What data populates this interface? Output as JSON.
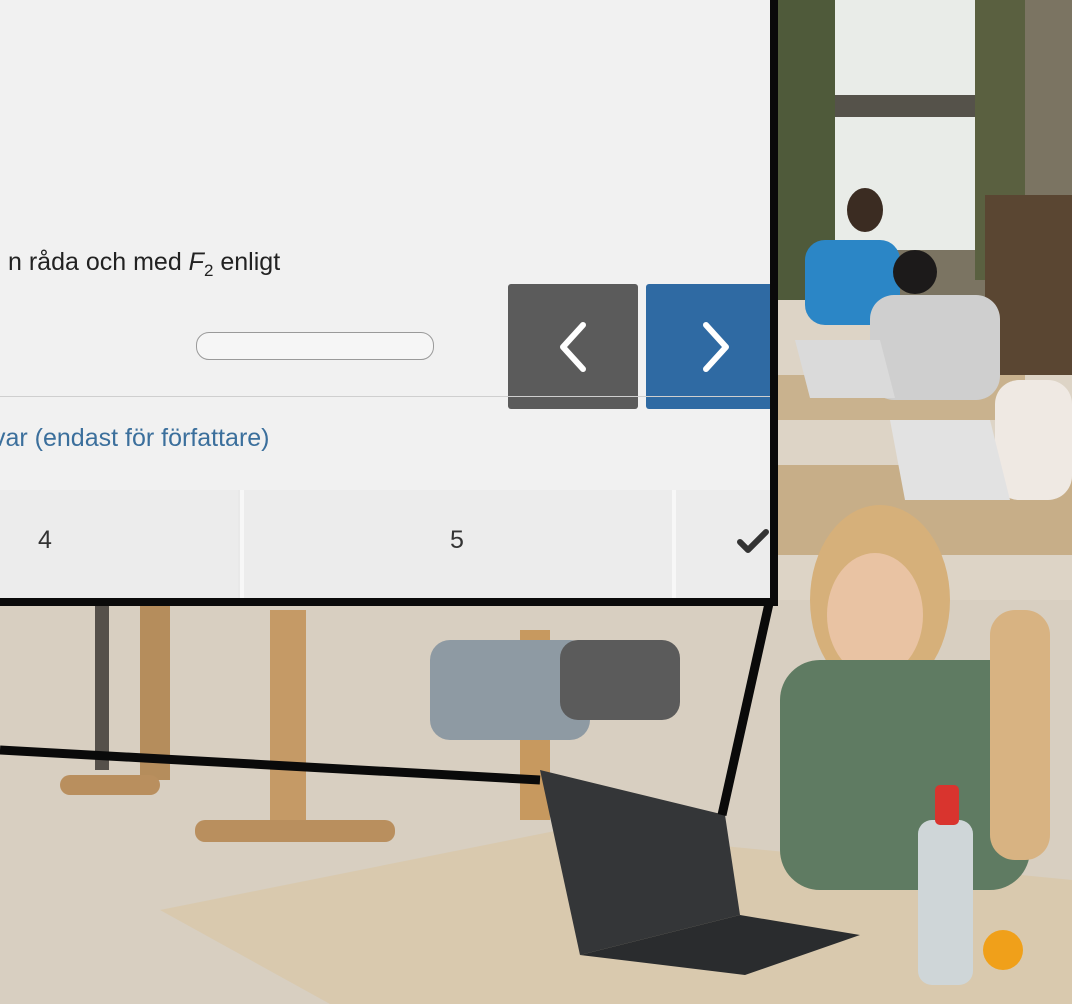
{
  "question": {
    "text_start": "n råda och med ",
    "math_var": "F",
    "math_sub": "2",
    "text_end": " enligt"
  },
  "answer_input": {
    "value": ""
  },
  "author_link": {
    "label": "var (endast för författare)"
  },
  "navigation": {
    "prev_icon": "chevron-left-icon",
    "next_icon": "chevron-right-icon"
  },
  "options": [
    {
      "label": "4"
    },
    {
      "label": "5"
    }
  ],
  "options_status_icon": "checkmark-icon",
  "colors": {
    "prev_button": "#5b5b5b",
    "next_button": "#2f6aa3",
    "link": "#3b6f9c",
    "panel_bg": "#f1f1f1"
  }
}
